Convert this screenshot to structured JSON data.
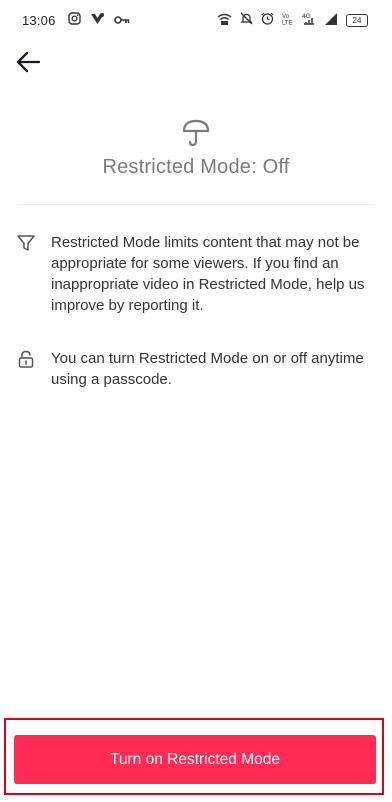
{
  "status_bar": {
    "time": "13:06",
    "battery": "24",
    "network": "4G",
    "left_icons": [
      "instagram-icon",
      "notification-app-icon",
      "key-icon"
    ],
    "right_icons": [
      "wifi-signal-icon",
      "mute-icon",
      "alarm-icon",
      "volte-icon",
      "signal-4g-icon",
      "sim-signal-icon",
      "battery-icon"
    ]
  },
  "header": {
    "back_icon": "arrow-left-icon",
    "mode_icon": "umbrella-icon",
    "title": "Restricted Mode: Off"
  },
  "info": [
    {
      "icon": "filter-icon",
      "text": "Restricted Mode limits content that may not be appropriate for some viewers. If you find an inappropriate video in Restricted Mode, help us improve by reporting it."
    },
    {
      "icon": "lock-icon",
      "text": "You can turn Restricted Mode on or off anytime using a passcode."
    }
  ],
  "action": {
    "button_label": "Turn on Restricted Mode",
    "button_color": "#FE2C55",
    "highlight_color": "#D7051A"
  }
}
